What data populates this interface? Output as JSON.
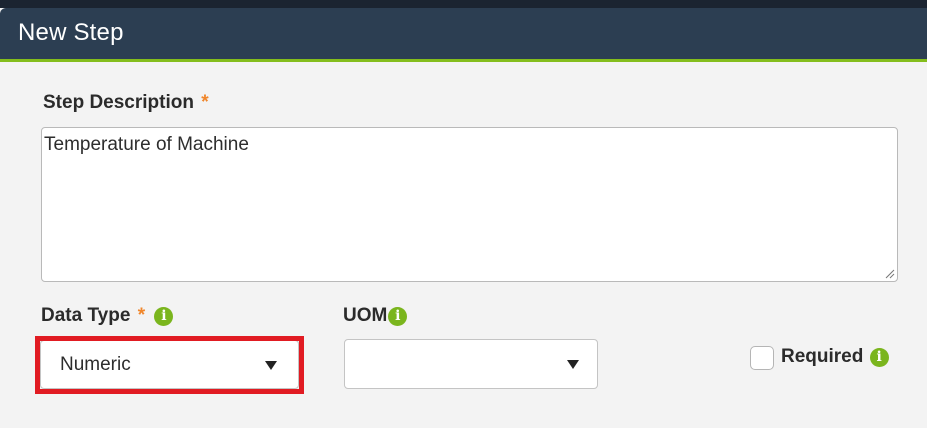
{
  "dialog": {
    "title": "New Step"
  },
  "form": {
    "step_description": {
      "label": "Step Description",
      "required_mark": "*",
      "value": "Temperature of Machine"
    },
    "data_type": {
      "label": "Data Type",
      "required_mark": "*",
      "info_icon": "info-icon",
      "selected": "Numeric"
    },
    "uom": {
      "label": "UOM",
      "info_icon": "info-icon",
      "selected": ""
    },
    "required": {
      "label": "Required",
      "checked": false,
      "info_icon": "info-icon"
    }
  },
  "colors": {
    "header_bg": "#2c3e52",
    "header_accent": "#84bd1c",
    "required_star": "#f0862b",
    "info_icon": "#7ab51d",
    "highlight_border": "#e11b22"
  }
}
